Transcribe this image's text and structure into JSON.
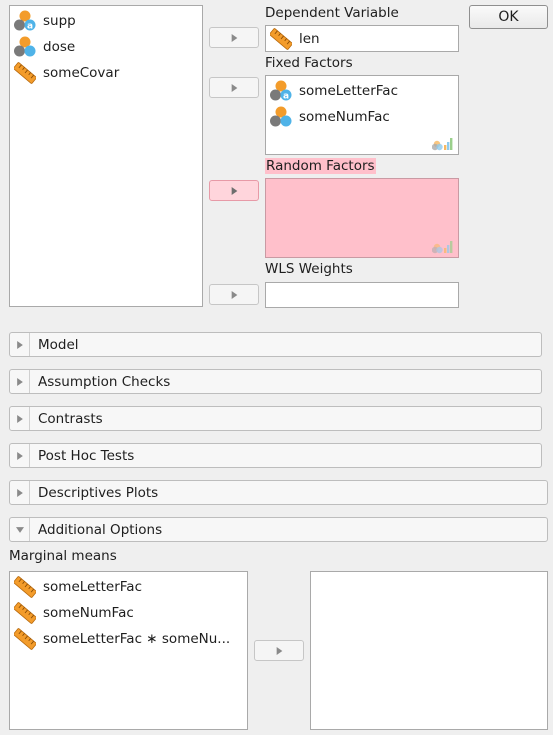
{
  "dialog": {
    "ok_label": "OK"
  },
  "source_vars": [
    {
      "label": "supp",
      "icon": "nominal-text-icon"
    },
    {
      "label": "dose",
      "icon": "nominal-icon"
    },
    {
      "label": "someCovar",
      "icon": "scale-ruler-icon"
    }
  ],
  "dependent": {
    "title": "Dependent Variable",
    "value": "len",
    "icon": "scale-ruler-icon"
  },
  "fixed": {
    "title": "Fixed Factors",
    "items": [
      {
        "label": "someLetterFac",
        "icon": "nominal-text-icon"
      },
      {
        "label": "someNumFac",
        "icon": "nominal-icon"
      }
    ]
  },
  "random": {
    "title": "Random Factors",
    "highlight_color": "#ffc0cb"
  },
  "wls": {
    "title": "WLS Weights"
  },
  "sections": [
    {
      "label": "Model",
      "expanded": false
    },
    {
      "label": "Assumption Checks",
      "expanded": false
    },
    {
      "label": "Contrasts",
      "expanded": false
    },
    {
      "label": "Post Hoc Tests",
      "expanded": false
    },
    {
      "label": "Descriptives Plots",
      "expanded": false
    },
    {
      "label": "Additional Options",
      "expanded": true
    }
  ],
  "marginal": {
    "title": "Marginal means",
    "items": [
      {
        "label": "someLetterFac",
        "icon": "scale-ruler-icon"
      },
      {
        "label": "someNumFac",
        "icon": "scale-ruler-icon"
      },
      {
        "label": "someLetterFac ∗ someNu...",
        "icon": "scale-ruler-icon"
      }
    ]
  },
  "colors": {
    "accent_orange": "#f39c2b",
    "nominal_blue": "#4fb3e8",
    "grey_circle": "#7a7a7a"
  }
}
